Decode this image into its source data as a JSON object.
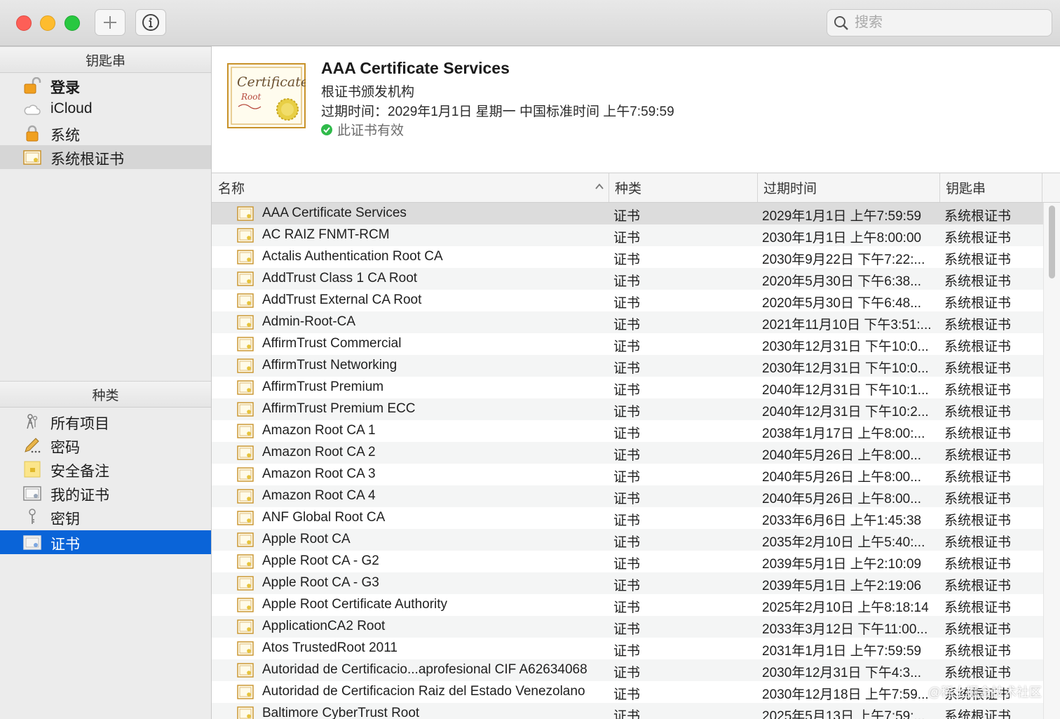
{
  "toolbar": {
    "add_icon": "plus-icon",
    "info_icon": "info-icon",
    "search_placeholder": "搜索"
  },
  "sidebar": {
    "keychains_header": "钥匙串",
    "keychains": [
      {
        "label": "登录",
        "icon": "lock-open-icon"
      },
      {
        "label": "iCloud",
        "icon": "cloud-icon"
      },
      {
        "label": "系统",
        "icon": "lock-icon"
      },
      {
        "label": "系统根证书",
        "icon": "certificate-icon"
      }
    ],
    "category_header": "种类",
    "categories": [
      {
        "label": "所有项目",
        "icon": "all-items-icon"
      },
      {
        "label": "密码",
        "icon": "pencil-icon"
      },
      {
        "label": "安全备注",
        "icon": "note-icon"
      },
      {
        "label": "我的证书",
        "icon": "my-certificate-icon"
      },
      {
        "label": "密钥",
        "icon": "key-icon"
      },
      {
        "label": "证书",
        "icon": "certificate-icon"
      }
    ]
  },
  "detail": {
    "title": "AAA Certificate Services",
    "subtitle": "根证书颁发机构",
    "expiry": "过期时间：2029年1月1日 星期一 中国标准时间 上午7:59:59",
    "status": "此证书有效",
    "cert_image_text": "Certificate",
    "cert_image_subtext": "Root"
  },
  "table": {
    "columns": [
      "名称",
      "种类",
      "过期时间",
      "钥匙串"
    ],
    "rows": [
      {
        "name": "AAA Certificate Services",
        "kind": "证书",
        "expires": "2029年1月1日 上午7:59:59",
        "keychain": "系统根证书"
      },
      {
        "name": "AC RAIZ FNMT-RCM",
        "kind": "证书",
        "expires": "2030年1月1日 上午8:00:00",
        "keychain": "系统根证书"
      },
      {
        "name": "Actalis Authentication Root CA",
        "kind": "证书",
        "expires": "2030年9月22日 下午7:22:...",
        "keychain": "系统根证书"
      },
      {
        "name": "AddTrust Class 1 CA Root",
        "kind": "证书",
        "expires": "2020年5月30日 下午6:38...",
        "keychain": "系统根证书"
      },
      {
        "name": "AddTrust External CA Root",
        "kind": "证书",
        "expires": "2020年5月30日 下午6:48...",
        "keychain": "系统根证书"
      },
      {
        "name": "Admin-Root-CA",
        "kind": "证书",
        "expires": "2021年11月10日 下午3:51:...",
        "keychain": "系统根证书"
      },
      {
        "name": "AffirmTrust Commercial",
        "kind": "证书",
        "expires": "2030年12月31日 下午10:0...",
        "keychain": "系统根证书"
      },
      {
        "name": "AffirmTrust Networking",
        "kind": "证书",
        "expires": "2030年12月31日 下午10:0...",
        "keychain": "系统根证书"
      },
      {
        "name": "AffirmTrust Premium",
        "kind": "证书",
        "expires": "2040年12月31日 下午10:1...",
        "keychain": "系统根证书"
      },
      {
        "name": "AffirmTrust Premium ECC",
        "kind": "证书",
        "expires": "2040年12月31日 下午10:2...",
        "keychain": "系统根证书"
      },
      {
        "name": "Amazon Root CA 1",
        "kind": "证书",
        "expires": "2038年1月17日 上午8:00:...",
        "keychain": "系统根证书"
      },
      {
        "name": "Amazon Root CA 2",
        "kind": "证书",
        "expires": "2040年5月26日 上午8:00...",
        "keychain": "系统根证书"
      },
      {
        "name": "Amazon Root CA 3",
        "kind": "证书",
        "expires": "2040年5月26日 上午8:00...",
        "keychain": "系统根证书"
      },
      {
        "name": "Amazon Root CA 4",
        "kind": "证书",
        "expires": "2040年5月26日 上午8:00...",
        "keychain": "系统根证书"
      },
      {
        "name": "ANF Global Root CA",
        "kind": "证书",
        "expires": "2033年6月6日 上午1:45:38",
        "keychain": "系统根证书"
      },
      {
        "name": "Apple Root CA",
        "kind": "证书",
        "expires": "2035年2月10日 上午5:40:...",
        "keychain": "系统根证书"
      },
      {
        "name": "Apple Root CA - G2",
        "kind": "证书",
        "expires": "2039年5月1日 上午2:10:09",
        "keychain": "系统根证书"
      },
      {
        "name": "Apple Root CA - G3",
        "kind": "证书",
        "expires": "2039年5月1日 上午2:19:06",
        "keychain": "系统根证书"
      },
      {
        "name": "Apple Root Certificate Authority",
        "kind": "证书",
        "expires": "2025年2月10日 上午8:18:14",
        "keychain": "系统根证书"
      },
      {
        "name": "ApplicationCA2 Root",
        "kind": "证书",
        "expires": "2033年3月12日 下午11:00...",
        "keychain": "系统根证书"
      },
      {
        "name": "Atos TrustedRoot 2011",
        "kind": "证书",
        "expires": "2031年1月1日 上午7:59:59",
        "keychain": "系统根证书"
      },
      {
        "name": "Autoridad de Certificacio...aprofesional CIF A62634068",
        "kind": "证书",
        "expires": "2030年12月31日 下午4:3...",
        "keychain": "系统根证书"
      },
      {
        "name": "Autoridad de Certificacion Raiz del Estado Venezolano",
        "kind": "证书",
        "expires": "2030年12月18日 上午7:59...",
        "keychain": "系统根证书"
      },
      {
        "name": "Baltimore CyberTrust Root",
        "kind": "证书",
        "expires": "2025年5月13日 上午7:59:...",
        "keychain": "系统根证书"
      }
    ]
  },
  "watermark": "@稀土掘金技术社区",
  "colors": {
    "selection_blue": "#0a64d8",
    "valid_green": "#2fba4a"
  }
}
